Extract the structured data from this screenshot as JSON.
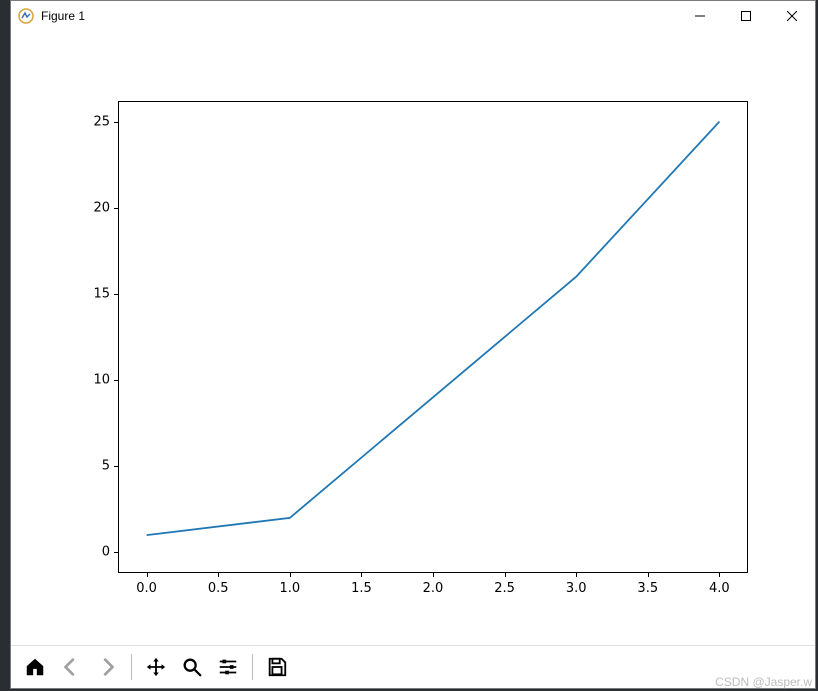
{
  "window": {
    "title": "Figure 1"
  },
  "chart_data": {
    "type": "line",
    "x": [
      0.0,
      1.0,
      2.0,
      3.0,
      4.0
    ],
    "y": [
      1,
      2,
      9,
      16,
      25
    ],
    "title": "",
    "xlabel": "",
    "ylabel": "",
    "xlim": [
      -0.2,
      4.2
    ],
    "ylim": [
      -1.2,
      26.2
    ],
    "xticks": [
      0.0,
      0.5,
      1.0,
      1.5,
      2.0,
      2.5,
      3.0,
      3.5,
      4.0
    ],
    "yticks": [
      0,
      5,
      10,
      15,
      20,
      25
    ],
    "xtick_labels": [
      "0.0",
      "0.5",
      "1.0",
      "1.5",
      "2.0",
      "2.5",
      "3.0",
      "3.5",
      "4.0"
    ],
    "ytick_labels": [
      "0",
      "5",
      "10",
      "15",
      "20",
      "25"
    ],
    "line_color": "#1f77b4"
  },
  "toolbar": {
    "home": "Home",
    "back": "Back",
    "forward": "Forward",
    "pan": "Pan",
    "zoom": "Zoom",
    "configure": "Configure subplots",
    "save": "Save"
  },
  "watermark": "CSDN @Jasper.w"
}
